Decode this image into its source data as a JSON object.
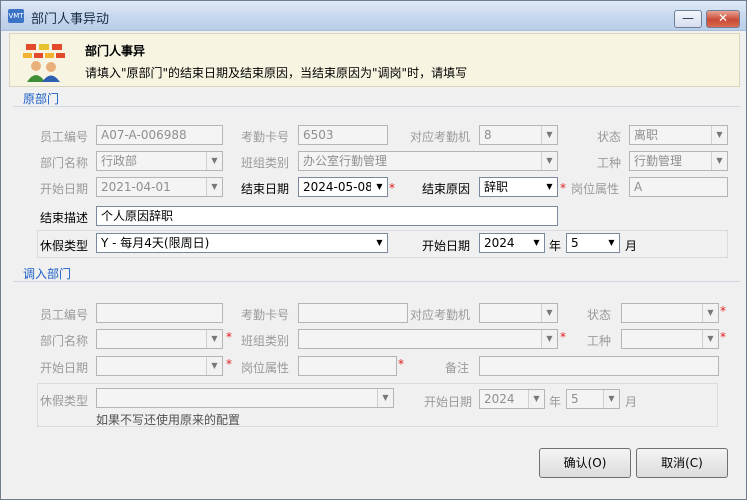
{
  "window": {
    "title": "部门人事异动",
    "icon_text": "VMT",
    "minimize_label": "—",
    "close_label": "✕"
  },
  "header": {
    "title": "部门人事异",
    "description": "请填入\"原部门\"的结束日期及结束原因，当结束原因为\"调岗\"时，请填写"
  },
  "original": {
    "section_title": "原部门",
    "emp_no": {
      "label": "员工编号",
      "value": "A07-A-006988"
    },
    "card_no": {
      "label": "考勤卡号",
      "value": "6503"
    },
    "att_machine": {
      "label": "对应考勤机",
      "value": "8"
    },
    "status": {
      "label": "状态",
      "value": "离职"
    },
    "dept_name": {
      "label": "部门名称",
      "value": "行政部"
    },
    "team_type": {
      "label": "班组类别",
      "value": "办公室行勤管理"
    },
    "job_type": {
      "label": "工种",
      "value": "行勤管理"
    },
    "start_date": {
      "label": "开始日期",
      "value": "2021-04-01"
    },
    "end_date": {
      "label": "结束日期",
      "value": "2024-05-08"
    },
    "end_reason": {
      "label": "结束原因",
      "value": "辞职"
    },
    "post_attr": {
      "label": "岗位属性",
      "value": "A"
    },
    "end_desc": {
      "label": "结束描述",
      "value": "个人原因辞职"
    },
    "leave_type": {
      "label": "休假类型",
      "value": "Y - 每月4天(限周日)"
    },
    "leave_start": {
      "label": "开始日期",
      "year": "2024",
      "year_unit": "年",
      "month": "5",
      "month_unit": "月"
    }
  },
  "transfer": {
    "section_title": "调入部门",
    "emp_no": {
      "label": "员工编号",
      "value": ""
    },
    "card_no": {
      "label": "考勤卡号",
      "value": ""
    },
    "att_machine": {
      "label": "对应考勤机",
      "value": ""
    },
    "status": {
      "label": "状态",
      "value": ""
    },
    "dept_name": {
      "label": "部门名称",
      "value": ""
    },
    "team_type": {
      "label": "班组类别",
      "value": ""
    },
    "job_type": {
      "label": "工种",
      "value": ""
    },
    "start_date": {
      "label": "开始日期",
      "value": ""
    },
    "post_attr": {
      "label": "岗位属性",
      "value": ""
    },
    "remark": {
      "label": "备注",
      "value": ""
    },
    "leave_type": {
      "label": "休假类型",
      "value": ""
    },
    "leave_note": "如果不写还使用原来的配置",
    "leave_start": {
      "label": "开始日期",
      "year": "2024",
      "year_unit": "年",
      "month": "5",
      "month_unit": "月"
    }
  },
  "buttons": {
    "ok": "确认(O)",
    "cancel": "取消(C)"
  },
  "colors": {
    "section_title": "#1c5ec6",
    "required": "#e02020",
    "header_bg": "#f7f5e2"
  }
}
